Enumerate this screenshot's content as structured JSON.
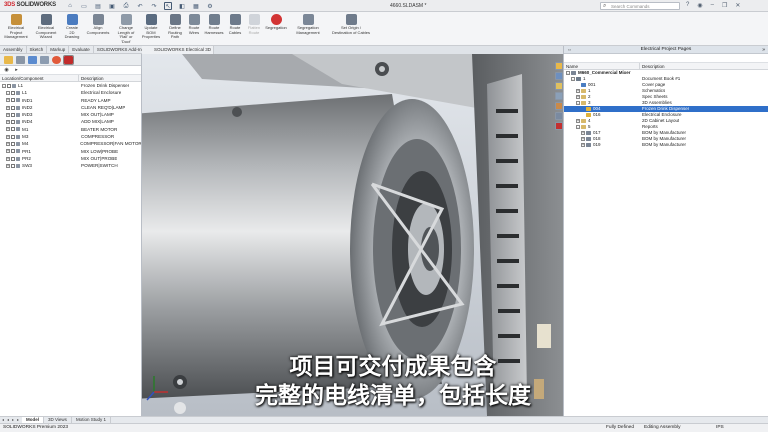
{
  "app": {
    "brand": "SOLIDWORKS",
    "document_title": "4660.SLDASM *",
    "search_placeholder": "Search Commands"
  },
  "ribbon": {
    "buttons": [
      {
        "label": "Electrical\nProject\nManagement",
        "icon": "project-management-icon",
        "enabled": true
      },
      {
        "label": "Electrical\nComponent\nWizard",
        "icon": "component-wizard-icon",
        "enabled": true
      },
      {
        "label": "Create\n2D\nDrawing",
        "icon": "create-drawing-icon",
        "enabled": true
      },
      {
        "label": "Align\nComponents",
        "icon": "align-icon",
        "enabled": true
      },
      {
        "label": "Change\nLength of\n'Rail' or\n'Duct'",
        "icon": "rail-length-icon",
        "enabled": true
      },
      {
        "label": "Update\nBOM\nProperties",
        "icon": "bom-update-icon",
        "enabled": true
      },
      {
        "label": "Define\nRouting\nPath",
        "icon": "routing-path-icon",
        "enabled": true
      },
      {
        "label": "Route\nWires",
        "icon": "route-wires-icon",
        "enabled": true
      },
      {
        "label": "Route\nHarnesses",
        "icon": "route-harness-icon",
        "enabled": true
      },
      {
        "label": "Route\nCables",
        "icon": "route-cables-icon",
        "enabled": true
      },
      {
        "label": "Flatten\nRoute",
        "icon": "flatten-route-icon",
        "enabled": false
      },
      {
        "label": "Segregation",
        "icon": "segregation-icon",
        "enabled": true
      },
      {
        "label": "Segregation\nManagement",
        "icon": "segregation-management-icon",
        "enabled": true
      },
      {
        "label": "Set Origin /\nDestination of Cables",
        "icon": "origin-destination-icon",
        "enabled": true
      }
    ]
  },
  "command_tabs": [
    "Assembly",
    "Sketch",
    "Markup",
    "Evaluate",
    "SOLIDWORKS Add-Ins"
  ],
  "view_tab": "SOLIDWORKS Electrical 3D",
  "left_panel": {
    "col_location": "Location/Component",
    "col_description": "Description",
    "rows": [
      {
        "name": "L1",
        "desc": "Frozen Drink Dispenser",
        "level": 0,
        "expand": "-"
      },
      {
        "name": "L1",
        "desc": "Electrical Enclosure",
        "level": 1,
        "expand": "-"
      },
      {
        "name": "IND1",
        "desc": "READY LAMP",
        "level": 1,
        "expand": "+"
      },
      {
        "name": "IND2",
        "desc": "CLEAN REQ'D|LAMP",
        "level": 1,
        "expand": "+"
      },
      {
        "name": "IND3",
        "desc": "MIX OUT|LAMP",
        "level": 1,
        "expand": "+"
      },
      {
        "name": "IND4",
        "desc": "ADD MIX|LAMP",
        "level": 1,
        "expand": "+"
      },
      {
        "name": "M1",
        "desc": "BEATER MOTOR",
        "level": 1,
        "expand": "+"
      },
      {
        "name": "M3",
        "desc": "COMPRESSOR",
        "level": 1,
        "expand": "+"
      },
      {
        "name": "M4",
        "desc": "COMPRESSOR|FAN MOTOR",
        "level": 1,
        "expand": "+"
      },
      {
        "name": "PR1",
        "desc": "MIX LOW|PROBE",
        "level": 1,
        "expand": "+"
      },
      {
        "name": "PR2",
        "desc": "MIX OUT|PROBE",
        "level": 1,
        "expand": "+"
      },
      {
        "name": "SW3",
        "desc": "POWER|SWITCH",
        "level": 1,
        "expand": "+"
      }
    ]
  },
  "right_panel": {
    "title": "Electrical Project Pages",
    "col_name": "Name",
    "col_description": "Description",
    "rows": [
      {
        "name": "M660_Commercial Mixer",
        "desc": "",
        "level": 0,
        "expand": "-",
        "bold": true,
        "icon_color": "#7a8594"
      },
      {
        "name": "1",
        "desc": "Document Book #1",
        "level": 1,
        "expand": "-",
        "bold": false,
        "icon_color": "#6c7a8a"
      },
      {
        "name": "001",
        "desc": "Cover page",
        "level": 2,
        "expand": "",
        "bold": false,
        "icon_color": "#4a7dc2"
      },
      {
        "name": "1",
        "desc": "Schematics",
        "level": 2,
        "expand": "+",
        "bold": false,
        "icon_color": "#d7b86a"
      },
      {
        "name": "2",
        "desc": "Spec Sheets",
        "level": 2,
        "expand": "+",
        "bold": false,
        "icon_color": "#d7b86a"
      },
      {
        "name": "3",
        "desc": "3D Assemblies",
        "level": 2,
        "expand": "-",
        "bold": false,
        "icon_color": "#d7b86a"
      },
      {
        "name": "004",
        "desc": "Frozen Drink Dispenser",
        "level": 3,
        "expand": "",
        "bold": false,
        "icon_color": "#e0b23a",
        "selected": true
      },
      {
        "name": "016",
        "desc": "Electrical Enclosure",
        "level": 3,
        "expand": "",
        "bold": false,
        "icon_color": "#e0b23a"
      },
      {
        "name": "4",
        "desc": "2D Cabinet Layout",
        "level": 2,
        "expand": "+",
        "bold": false,
        "icon_color": "#d7b86a"
      },
      {
        "name": "5",
        "desc": "Reports",
        "level": 2,
        "expand": "-",
        "bold": false,
        "icon_color": "#d7b86a"
      },
      {
        "name": "017",
        "desc": "BOM by Manufacturer",
        "level": 3,
        "expand": "+",
        "bold": false,
        "icon_color": "#7a8594"
      },
      {
        "name": "018",
        "desc": "BOM by Manufacturer",
        "level": 3,
        "expand": "+",
        "bold": false,
        "icon_color": "#7a8594"
      },
      {
        "name": "019",
        "desc": "BOM by Manufacturer",
        "level": 3,
        "expand": "+",
        "bold": false,
        "icon_color": "#7a8594"
      }
    ]
  },
  "subtitle": {
    "line1": "项目可交付成果包含",
    "line2": "完整的电线清单，包括长度"
  },
  "bottom_tabs": [
    "Model",
    "3D Views",
    "Motion Study 1"
  ],
  "status": {
    "product": "SOLIDWORKS Premium 2023",
    "state1": "Fully Defined",
    "state2": "Editing Assembly",
    "units": "IPS"
  },
  "colors": {
    "accent": "#2f6fc9",
    "brand_red": "#d0262e",
    "selection": "#2f6fc9"
  }
}
